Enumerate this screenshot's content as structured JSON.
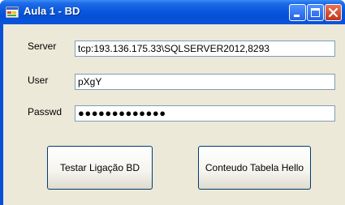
{
  "window": {
    "title": "Aula 1 - BD"
  },
  "titlebar_icons": {
    "app": "app-icon",
    "minimize": "minimize-icon",
    "maximize": "maximize-icon",
    "close": "close-icon"
  },
  "form": {
    "server_label": "Server",
    "server_value": "tcp:193.136.175.33\\SQLSERVER2012,8293",
    "user_label": "User",
    "user_value": "pXgY",
    "password_label": "Passwd",
    "password_mask": "●●●●●●●●●●●●●"
  },
  "buttons": {
    "test_connection": "Testar Ligação BD",
    "table_content": "Conteudo Tabela Hello"
  }
}
